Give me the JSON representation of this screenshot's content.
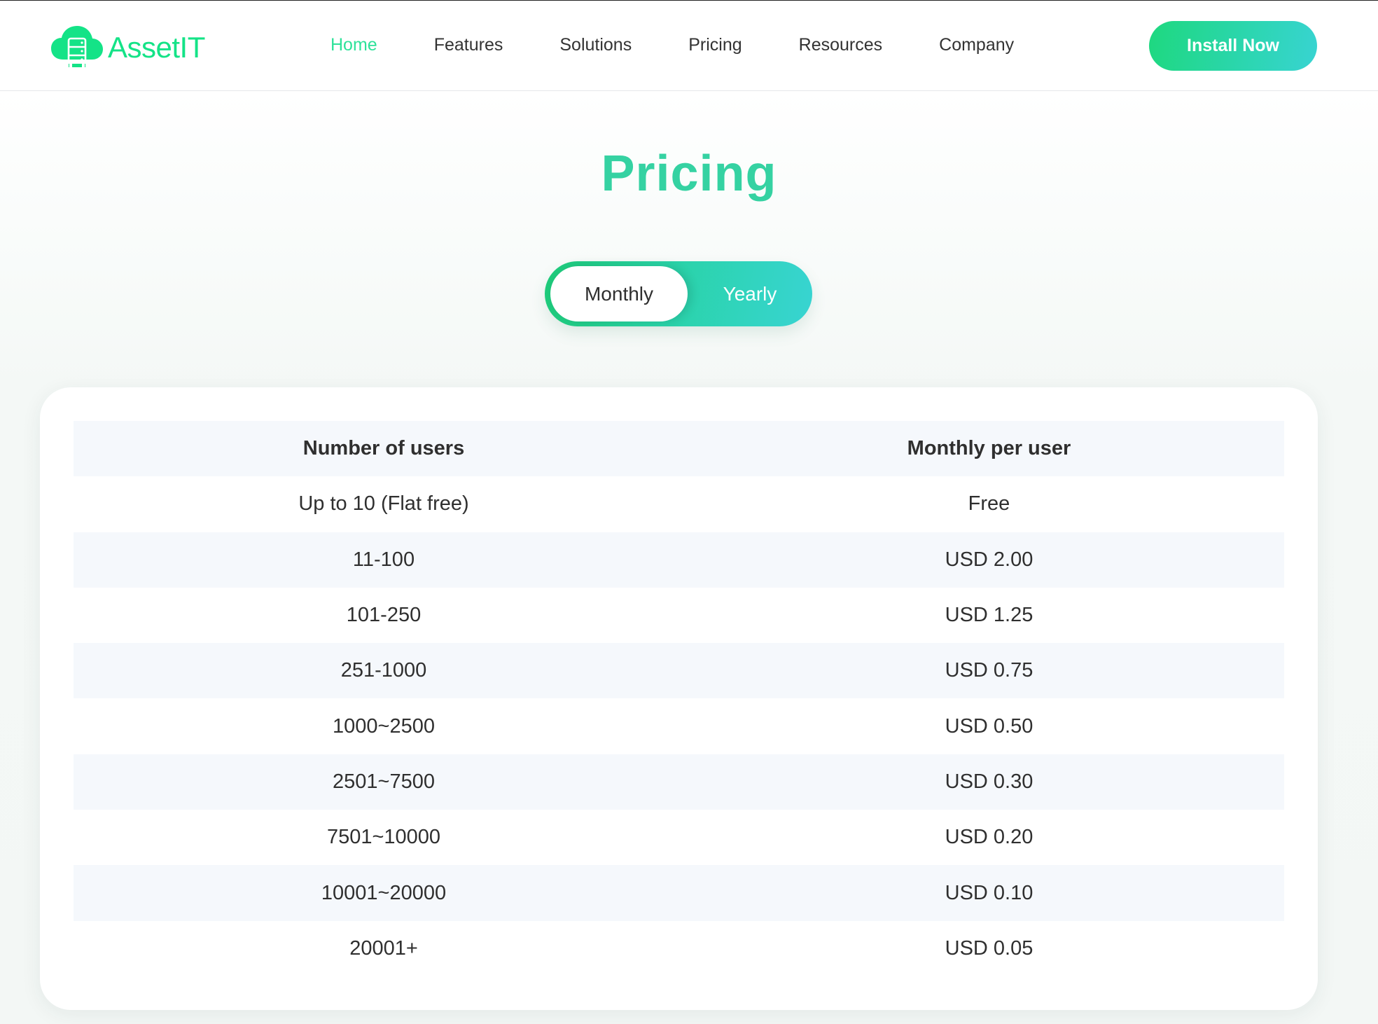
{
  "header": {
    "logo_text": "AssetIT",
    "logo_icon": "cloud-server-icon",
    "nav": [
      {
        "label": "Home",
        "active": true
      },
      {
        "label": "Features",
        "active": false
      },
      {
        "label": "Solutions",
        "active": false
      },
      {
        "label": "Pricing",
        "active": false
      },
      {
        "label": "Resources",
        "active": false
      },
      {
        "label": "Company",
        "active": false
      }
    ],
    "cta_label": "Install Now"
  },
  "page": {
    "title": "Pricing",
    "billing_toggle": {
      "options": [
        "Monthly",
        "Yearly"
      ],
      "selected": "Monthly"
    }
  },
  "pricing_table": {
    "columns": [
      "Number of users",
      "Monthly per user"
    ],
    "rows": [
      [
        "Up to 10 (Flat free)",
        "Free"
      ],
      [
        "11-100",
        "USD 2.00"
      ],
      [
        "101-250",
        "USD 1.25"
      ],
      [
        "251-1000",
        "USD 0.75"
      ],
      [
        "1000~2500",
        "USD 0.50"
      ],
      [
        "2501~7500",
        "USD 0.30"
      ],
      [
        "7501~10000",
        "USD 0.20"
      ],
      [
        "10001~20000",
        "USD 0.10"
      ],
      [
        "20001+",
        "USD 0.05"
      ]
    ]
  },
  "colors": {
    "brand_green": "#14e387",
    "nav_active": "#2ee29a",
    "title": "#35d2a2",
    "gradient_start": "#1ed87f",
    "gradient_end": "#38d4d2",
    "row_stripe": "#f5f8fc",
    "text": "#2f2f2f"
  }
}
